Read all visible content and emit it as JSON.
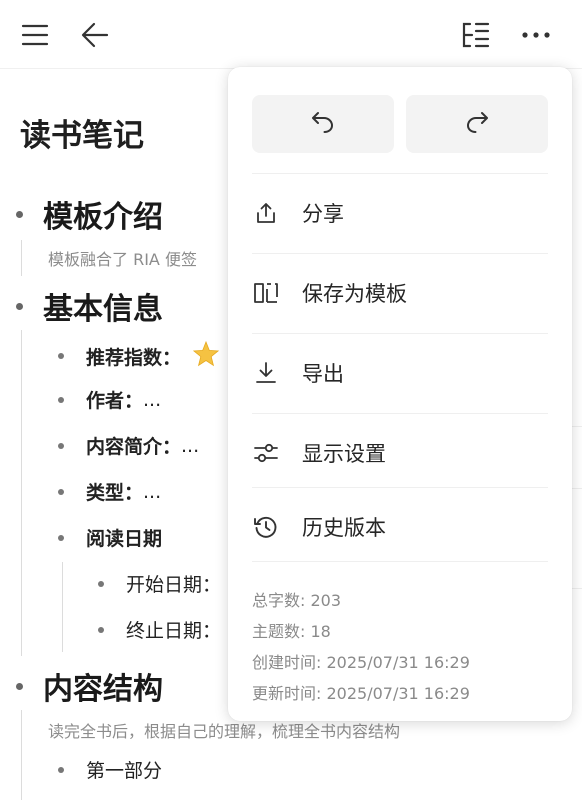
{
  "document": {
    "title": "读书笔记",
    "sections": [
      {
        "heading": "模板介绍",
        "note": "模板融合了 RIA 便签"
      },
      {
        "heading": "基本信息",
        "items": [
          {
            "label": "推荐指数：",
            "value": ""
          },
          {
            "label": "作者：",
            "value": "..."
          },
          {
            "label": "内容简介：",
            "value": "..."
          },
          {
            "label": "类型：",
            "value": "..."
          },
          {
            "label": "阅读日期",
            "value": "",
            "children": [
              {
                "label": "开始日期："
              },
              {
                "label": "终止日期："
              }
            ]
          }
        ]
      },
      {
        "heading": "内容结构",
        "note": "读完全书后，根据自己的理解，梳理全书内容结构",
        "items": [
          {
            "label": "第一部分"
          }
        ]
      }
    ]
  },
  "menu": {
    "items": [
      {
        "label": "分享",
        "icon": "share-icon"
      },
      {
        "label": "保存为模板",
        "icon": "template-icon"
      },
      {
        "label": "导出",
        "icon": "export-icon"
      },
      {
        "label": "显示设置",
        "icon": "settings-sliders-icon"
      },
      {
        "label": "历史版本",
        "icon": "history-icon"
      }
    ],
    "stats": {
      "word_count": "总字数: 203",
      "topic_count": "主题数: 18",
      "created": "创建时间:  2025/07/31 16:29",
      "updated": "更新时间:  2025/07/31 16:29"
    }
  },
  "colors": {
    "accent_star": "#f5c242",
    "menu_bg": "#ffffff",
    "button_bg": "#f3f3f3"
  }
}
